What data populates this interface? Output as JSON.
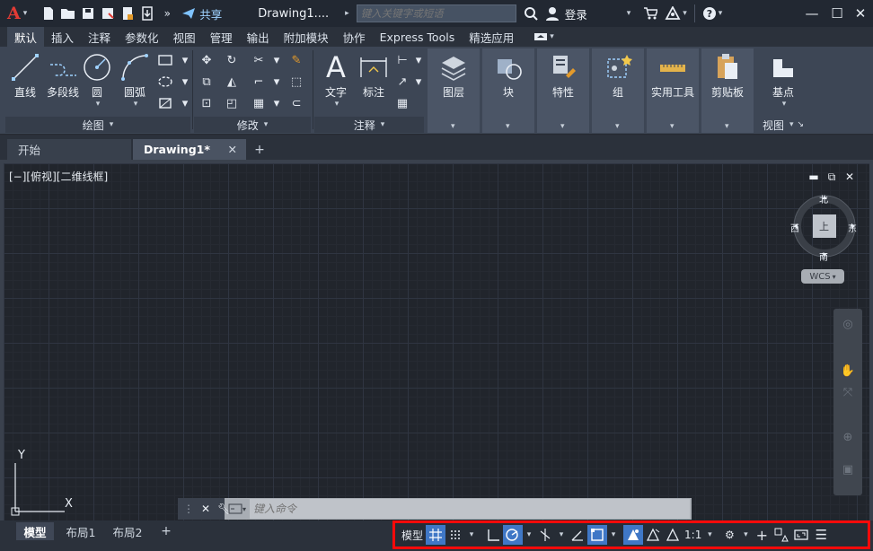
{
  "titlebar": {
    "share_label": "共享",
    "doc_title": "Drawing1....",
    "search_placeholder": "键入关键字或短语",
    "login_label": "登录"
  },
  "ribbon_tabs": [
    "默认",
    "插入",
    "注释",
    "参数化",
    "视图",
    "管理",
    "输出",
    "附加模块",
    "协作",
    "Express Tools",
    "精选应用"
  ],
  "ribbon": {
    "draw": {
      "line": "直线",
      "polyline": "多段线",
      "circle": "圆",
      "arc": "圆弧",
      "label": "绘图"
    },
    "modify": {
      "label": "修改"
    },
    "annotation": {
      "text": "文字",
      "dimension": "标注",
      "label": "注释"
    },
    "layers": "图层",
    "block": "块",
    "properties": "特性",
    "groups": "组",
    "utilities": "实用工具",
    "clipboard": "剪贴板",
    "view": {
      "base": "基点",
      "label": "视图"
    }
  },
  "doc_tabs": {
    "start": "开始",
    "drawing": "Drawing1*"
  },
  "viewport": {
    "view_label": "[−][俯视][二维线框]",
    "compass": {
      "north": "北",
      "south": "南",
      "east": "东",
      "west": "西",
      "top": "上"
    },
    "wcs": "WCS",
    "ucs_y": "Y",
    "ucs_x": "X"
  },
  "command": {
    "placeholder": "键入命令"
  },
  "layout_tabs": [
    "模型",
    "布局1",
    "布局2"
  ],
  "status": {
    "model": "模型",
    "scale": "1:1"
  },
  "colors": {
    "accent": "#3f77c6",
    "highlight_border": "#ff0a0a",
    "logo": "#e23b35"
  }
}
